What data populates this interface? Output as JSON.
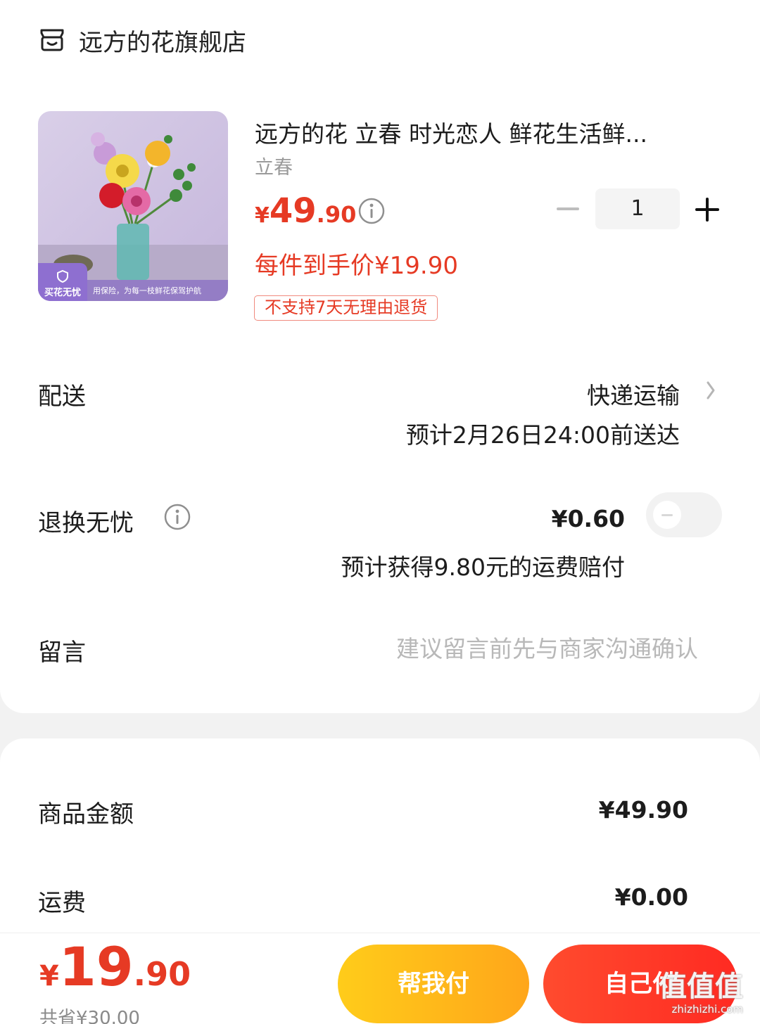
{
  "store": {
    "name": "远方的花旗舰店",
    "icon": "store-icon"
  },
  "product": {
    "title": "远方的花 立春 时光恋人 鲜花生活鲜...",
    "sku": "立春",
    "price_yen": "¥",
    "price_int": "49",
    "price_dec": ".90",
    "net_price": "每件到手价¥19.90",
    "return_tag": "不支持7天无理由退货",
    "image_badge_left": "买花无忧",
    "image_badge_text": "用保险，为每一枝鲜花保驾护航",
    "quantity": "1"
  },
  "delivery": {
    "label": "配送",
    "method": "快递运输",
    "eta": "预计2月26日24:00前送达"
  },
  "insurance": {
    "label": "退换无忧",
    "price": "¥0.60",
    "note": "预计获得9.80元的运费赔付",
    "enabled": false
  },
  "message": {
    "label": "留言",
    "placeholder": "建议留言前先与商家沟通确认",
    "value": ""
  },
  "summary": {
    "goods_label": "商品金额",
    "goods_value": "¥49.90",
    "shipping_label": "运费",
    "shipping_value": "¥0.00"
  },
  "checkout": {
    "total_yen": "¥",
    "total_int": "19",
    "total_dec": ".90",
    "saved": "共省¥30.00",
    "help_pay_label": "帮我付",
    "self_pay_label": "自己付"
  },
  "watermark": {
    "glyphs": "值值值",
    "url": "zhizhizhi.com"
  },
  "colors": {
    "accent_red": "#e63a24",
    "help_btn": "#ffb81a",
    "pay_btn": "#ff3a26"
  }
}
